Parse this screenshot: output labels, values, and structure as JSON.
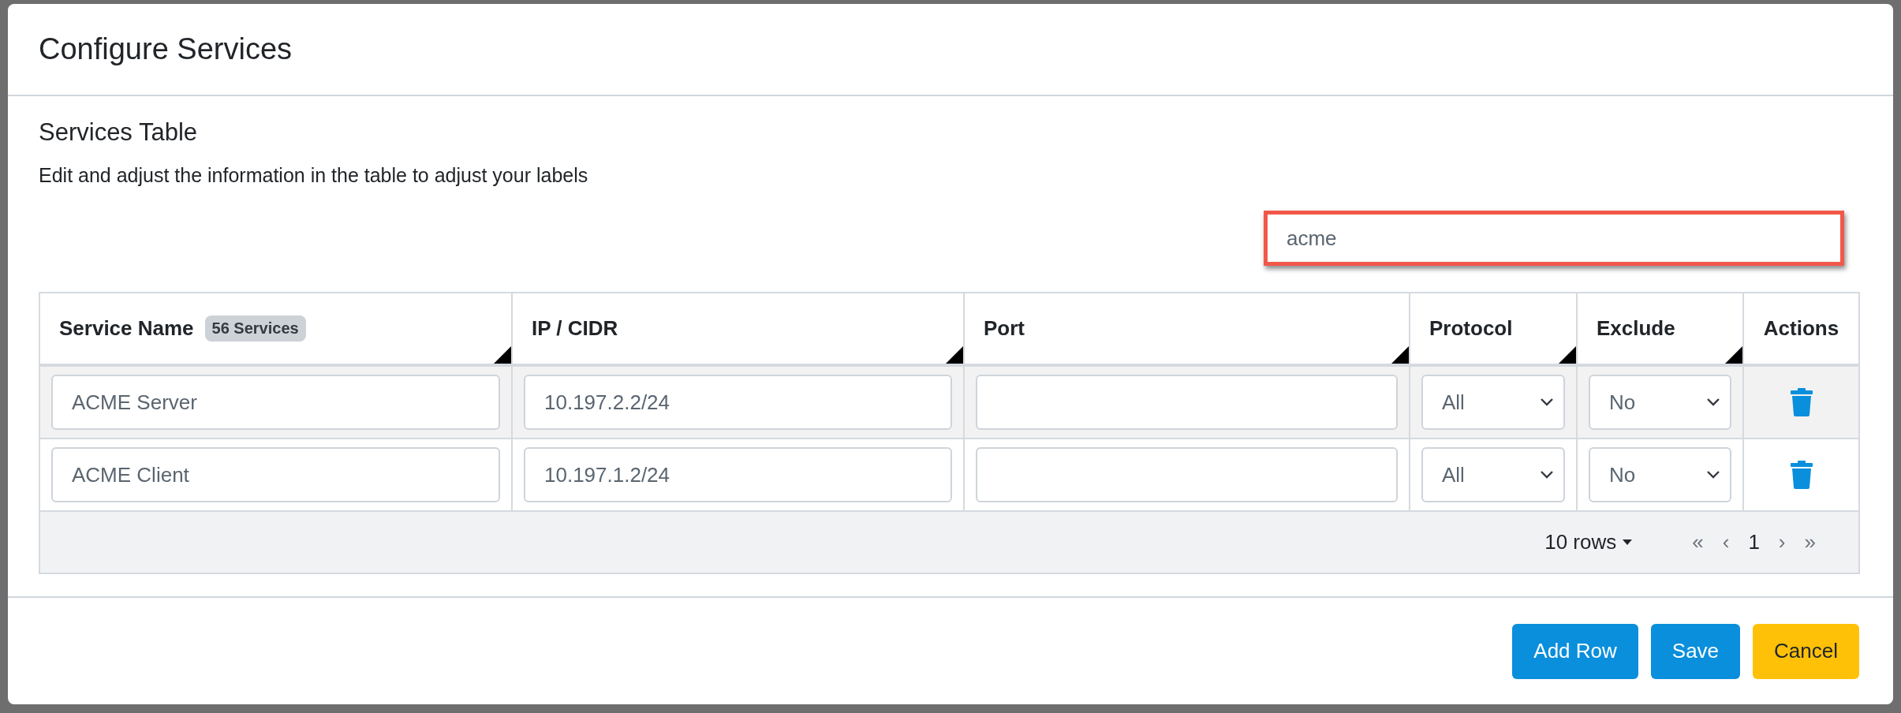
{
  "dialog": {
    "title": "Configure Services",
    "section_title": "Services Table",
    "description": "Edit and adjust the information in the table to adjust your labels",
    "search": {
      "value": "acme",
      "highlighted": true
    },
    "table": {
      "columns": [
        {
          "label": "Service Name",
          "badge": "56 Services",
          "resizable": true
        },
        {
          "label": "IP / CIDR",
          "resizable": true
        },
        {
          "label": "Port",
          "resizable": true
        },
        {
          "label": "Protocol",
          "resizable": true
        },
        {
          "label": "Exclude",
          "resizable": true
        },
        {
          "label": "Actions",
          "resizable": false
        }
      ],
      "rows": [
        {
          "striped": true,
          "cells": [
            {
              "kind": "input",
              "value": "ACME Server"
            },
            {
              "kind": "input",
              "value": "10.197.2.2/24"
            },
            {
              "kind": "input"
            },
            {
              "kind": "select",
              "value": "All"
            },
            {
              "kind": "select",
              "value": "No"
            },
            {
              "kind": "delete"
            }
          ]
        },
        {
          "striped": false,
          "cells": [
            {
              "kind": "input",
              "value": "ACME Client"
            },
            {
              "kind": "input",
              "value": "10.197.1.2/24"
            },
            {
              "kind": "input"
            },
            {
              "kind": "select",
              "value": "All"
            },
            {
              "kind": "select",
              "value": "No"
            },
            {
              "kind": "delete"
            }
          ]
        }
      ],
      "pagination": {
        "page_size": "10 rows",
        "first": "«",
        "prev": "‹",
        "page": "1",
        "next": "›",
        "last": "»"
      }
    },
    "buttons": [
      {
        "label": "Add Row",
        "kind": "primary"
      },
      {
        "label": "Save",
        "kind": "primary"
      },
      {
        "label": "Cancel",
        "kind": "warning"
      }
    ]
  }
}
